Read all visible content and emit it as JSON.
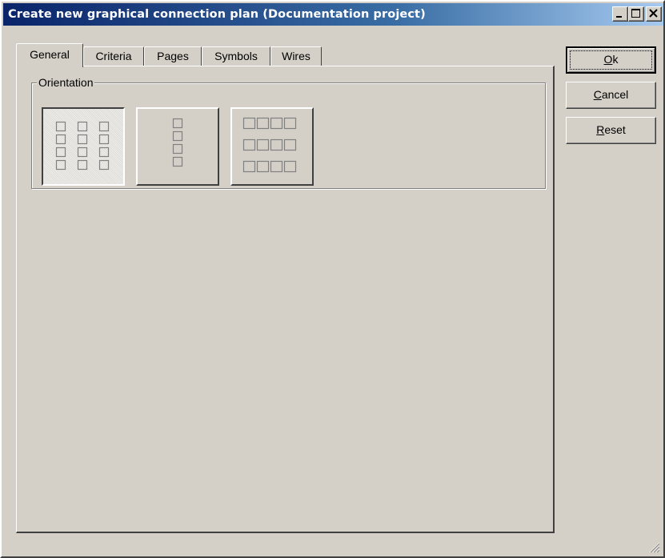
{
  "window": {
    "title": "Create new graphical connection plan (Documentation project)"
  },
  "title_buttons": [
    {
      "name": "minimize",
      "icon": "minimize-icon"
    },
    {
      "name": "maximize",
      "icon": "maximize-icon"
    },
    {
      "name": "close",
      "icon": "close-icon"
    }
  ],
  "tabs": [
    {
      "label": "General",
      "active": true
    },
    {
      "label": "Criteria",
      "active": false
    },
    {
      "label": "Pages",
      "active": false
    },
    {
      "label": "Symbols",
      "active": false
    },
    {
      "label": "Wires",
      "active": false
    }
  ],
  "orientation": {
    "label": "Orientation",
    "options": [
      {
        "icon": "grid-3x4-icon",
        "pressed": true
      },
      {
        "icon": "column-1x4-icon",
        "pressed": false
      },
      {
        "icon": "grid-4x3-icon",
        "pressed": false
      }
    ]
  },
  "buttons": {
    "ok": {
      "mnemonic": "O",
      "rest": "k"
    },
    "cancel": {
      "mnemonic": "C",
      "rest": "ancel"
    },
    "reset": {
      "mnemonic": "R",
      "rest": "eset"
    }
  },
  "colors": {
    "face": "#d4d0c8",
    "title_start": "#0a246a",
    "title_end": "#a6caf0",
    "icon_squares": "#808080"
  }
}
